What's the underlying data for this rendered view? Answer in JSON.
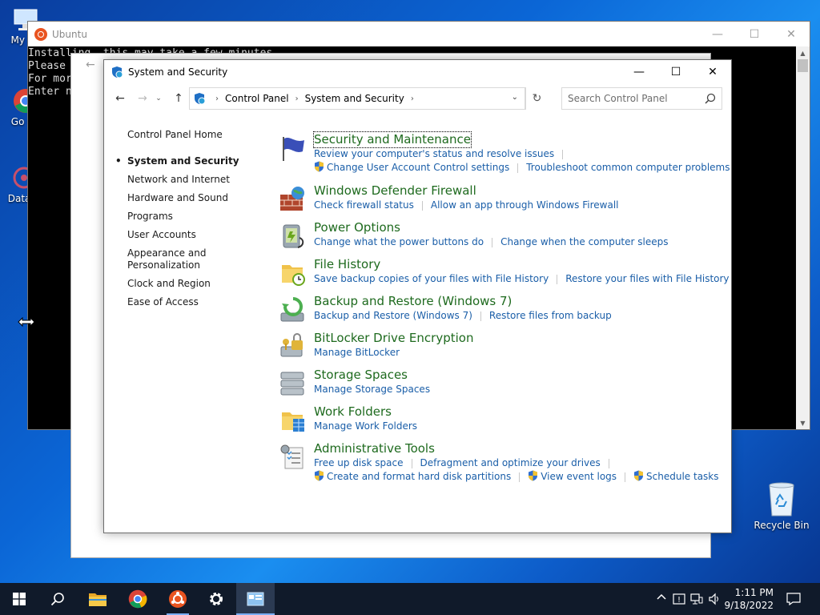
{
  "desktop": {
    "icons": [
      {
        "label": "My Co"
      },
      {
        "label": "Go Ch"
      },
      {
        "label": "DataW"
      },
      {
        "label": "Recycle Bin"
      }
    ]
  },
  "ubuntu": {
    "title": "Ubuntu",
    "terminal_lines": [
      "Installing, this may take a few minutes...",
      "Please ",
      "For mor",
      "Enter n"
    ]
  },
  "control_panel": {
    "title": "System and Security",
    "breadcrumb": [
      "Control Panel",
      "System and Security"
    ],
    "search_placeholder": "Search Control Panel",
    "left_pane": {
      "home": "Control Panel Home",
      "items": [
        {
          "label": "System and Security",
          "current": true
        },
        {
          "label": "Network and Internet"
        },
        {
          "label": "Hardware and Sound"
        },
        {
          "label": "Programs"
        },
        {
          "label": "User Accounts"
        },
        {
          "label": "Appearance and Personalization"
        },
        {
          "label": "Clock and Region"
        },
        {
          "label": "Ease of Access"
        }
      ]
    },
    "categories": [
      {
        "title": "Security and Maintenance",
        "rows": [
          [
            "Review your computer's status and resolve issues"
          ],
          [
            "Change User Account Control settings",
            "Troubleshoot common computer problems"
          ]
        ]
      },
      {
        "title": "Windows Defender Firewall",
        "rows": [
          [
            "Check firewall status",
            "Allow an app through Windows Firewall"
          ]
        ]
      },
      {
        "title": "Power Options",
        "rows": [
          [
            "Change what the power buttons do",
            "Change when the computer sleeps"
          ]
        ]
      },
      {
        "title": "File History",
        "rows": [
          [
            "Save backup copies of your files with File History",
            "Restore your files with File History"
          ]
        ]
      },
      {
        "title": "Backup and Restore (Windows 7)",
        "rows": [
          [
            "Backup and Restore (Windows 7)",
            "Restore files from backup"
          ]
        ]
      },
      {
        "title": "BitLocker Drive Encryption",
        "rows": [
          [
            "Manage BitLocker"
          ]
        ]
      },
      {
        "title": "Storage Spaces",
        "rows": [
          [
            "Manage Storage Spaces"
          ]
        ]
      },
      {
        "title": "Work Folders",
        "rows": [
          [
            "Manage Work Folders"
          ]
        ]
      },
      {
        "title": "Administrative Tools",
        "rows": [
          [
            "Free up disk space",
            "Defragment and optimize your drives"
          ],
          [
            "Create and format hard disk partitions",
            "View event logs",
            "Schedule tasks"
          ]
        ]
      }
    ]
  },
  "taskbar": {
    "time": "1:11 PM",
    "date": "9/18/2022"
  },
  "colors": {
    "category_title": "#1e6a1e",
    "link": "#1a5ea8",
    "taskbar": "#101a2a"
  }
}
